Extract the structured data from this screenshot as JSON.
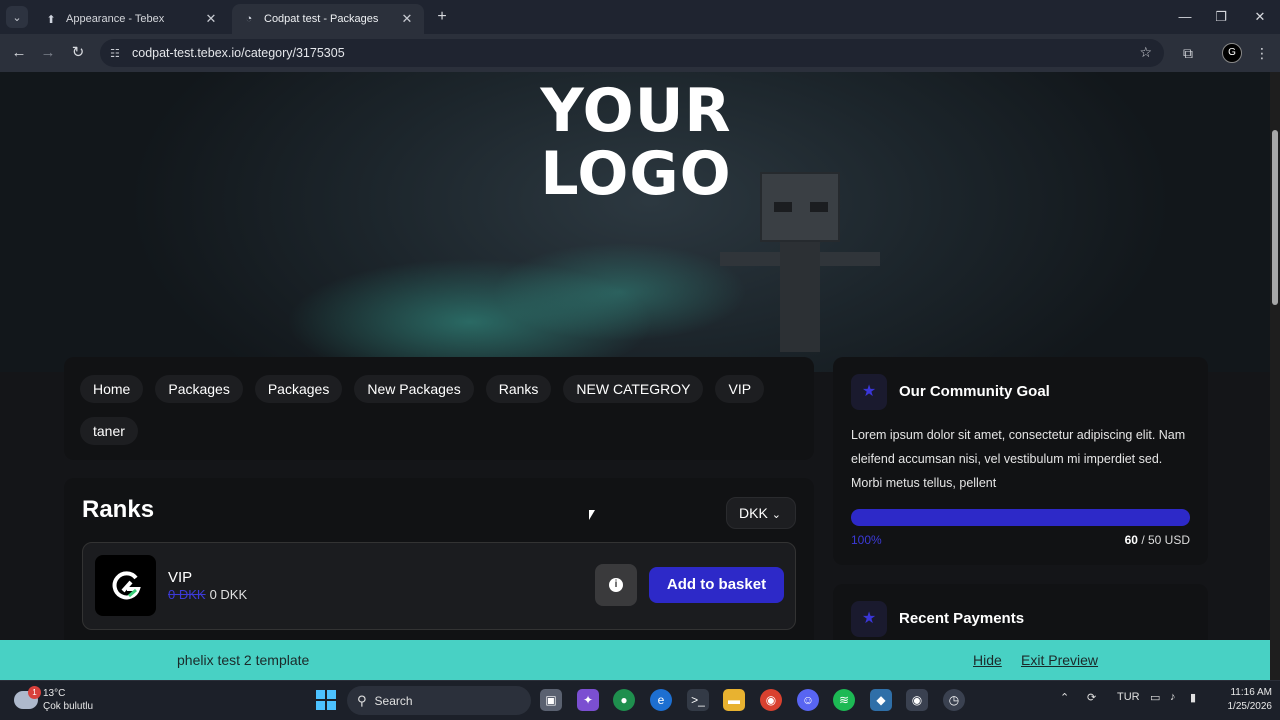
{
  "browser": {
    "tabs": [
      {
        "title": "Appearance - Tebex",
        "favicon": "tebex-icon"
      },
      {
        "title": "Codpat test - Packages",
        "favicon": "codpat-icon"
      }
    ],
    "url": "codpat-test.tebex.io/category/3175305"
  },
  "store": {
    "logo_line1": "YOUR",
    "logo_line2": "LOGO",
    "nav": [
      "Home",
      "Packages",
      "Packages",
      "New Packages",
      "Ranks",
      "NEW CATEGROY",
      "VIP",
      "taner"
    ],
    "category_title": "Ranks",
    "currency": "DKK",
    "package": {
      "name": "VIP",
      "old_price": "0 DKK",
      "price": "0 DKK",
      "button": "Add to basket"
    },
    "goal": {
      "title": "Our Community Goal",
      "text": "Lorem ipsum dolor sit amet, consectetur adipiscing elit. Nam eleifend accumsan nisi, vel vestibulum mi imperdiet sed. Morbi metus tellus, pellent",
      "percent_label": "100%",
      "progress": 1.0,
      "current": "60",
      "target": "/ 50 USD"
    },
    "payments_title": "Recent Payments"
  },
  "preview_bar": {
    "label": "phelix test 2 template",
    "hide": "Hide",
    "exit": "Exit Preview"
  },
  "taskbar": {
    "weather_temp": "13°C",
    "weather_condition": "Çok bulutlu",
    "weather_badge": "1",
    "search": "Search",
    "lang": "TUR",
    "time": "11:16 AM",
    "date": "1/25/2026"
  },
  "colors": {
    "accent": "#2d29c8",
    "preview_bar": "#48d1c4"
  }
}
